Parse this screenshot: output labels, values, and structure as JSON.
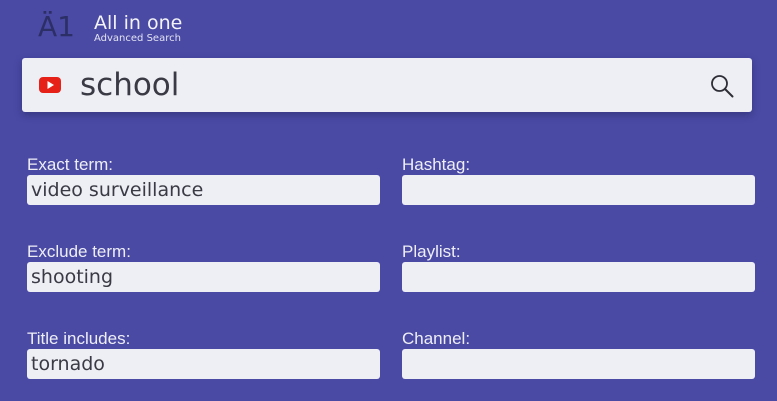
{
  "header": {
    "logo_text": "Ä1",
    "title": "All in one",
    "subtitle": "Advanced Search"
  },
  "search": {
    "value": "school",
    "source_icon": "youtube-icon",
    "search_icon": "search-icon"
  },
  "fields": {
    "exact_term": {
      "label": "Exact term:",
      "value": "video surveillance"
    },
    "hashtag": {
      "label": "Hashtag:",
      "value": ""
    },
    "exclude_term": {
      "label": "Exclude term:",
      "value": "shooting"
    },
    "playlist": {
      "label": "Playlist:",
      "value": ""
    },
    "title_includes": {
      "label": "Title includes:",
      "value": "tornado"
    },
    "channel": {
      "label": "Channel:",
      "value": ""
    }
  },
  "colors": {
    "background": "#4a4aa5",
    "field_background": "#eeeef5",
    "youtube_red": "#e62117",
    "label_text": "#eeeef7"
  }
}
